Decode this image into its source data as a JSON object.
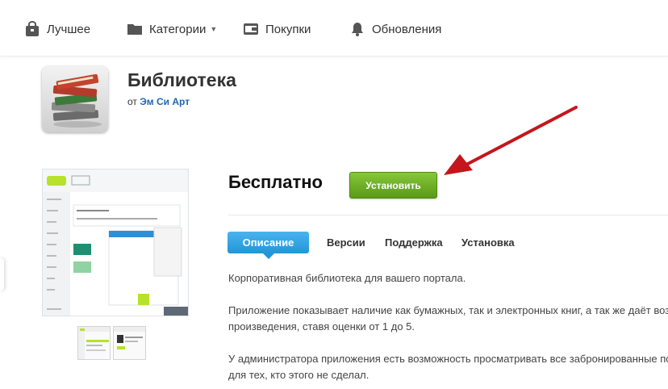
{
  "nav": {
    "items": [
      {
        "label": "Лучшее",
        "icon": "bag-icon"
      },
      {
        "label": "Категории",
        "icon": "folder-icon",
        "has_dropdown": true
      },
      {
        "label": "Покупки",
        "icon": "wallet-icon"
      },
      {
        "label": "Обновления",
        "icon": "bell-icon"
      }
    ]
  },
  "app": {
    "title": "Библиотека",
    "author_prefix": "от",
    "author": "Эм Си Арт",
    "icon": "books-icon"
  },
  "price": "Бесплатно",
  "install_label": "Установить",
  "tabs": [
    {
      "label": "Описание",
      "active": true
    },
    {
      "label": "Версии"
    },
    {
      "label": "Поддержка"
    },
    {
      "label": "Установка"
    }
  ],
  "description": {
    "p1": "Корпоративная библиотека для вашего портала.",
    "p2_line1": "Приложение показывает наличие как бумажных, так и электронных книг, а так же даёт воз",
    "p2_line2": "произведения, ставя оценки от 1 до 5.",
    "p3_line1": "У администратора приложения есть возможность просматривать все забронированные по",
    "p3_line2": "для тех, кто этого не сделал."
  },
  "colors": {
    "install_button": "#6fb127",
    "active_tab": "#2a9de0",
    "author_link": "#2067b0",
    "annotation_arrow": "#c4161c"
  }
}
